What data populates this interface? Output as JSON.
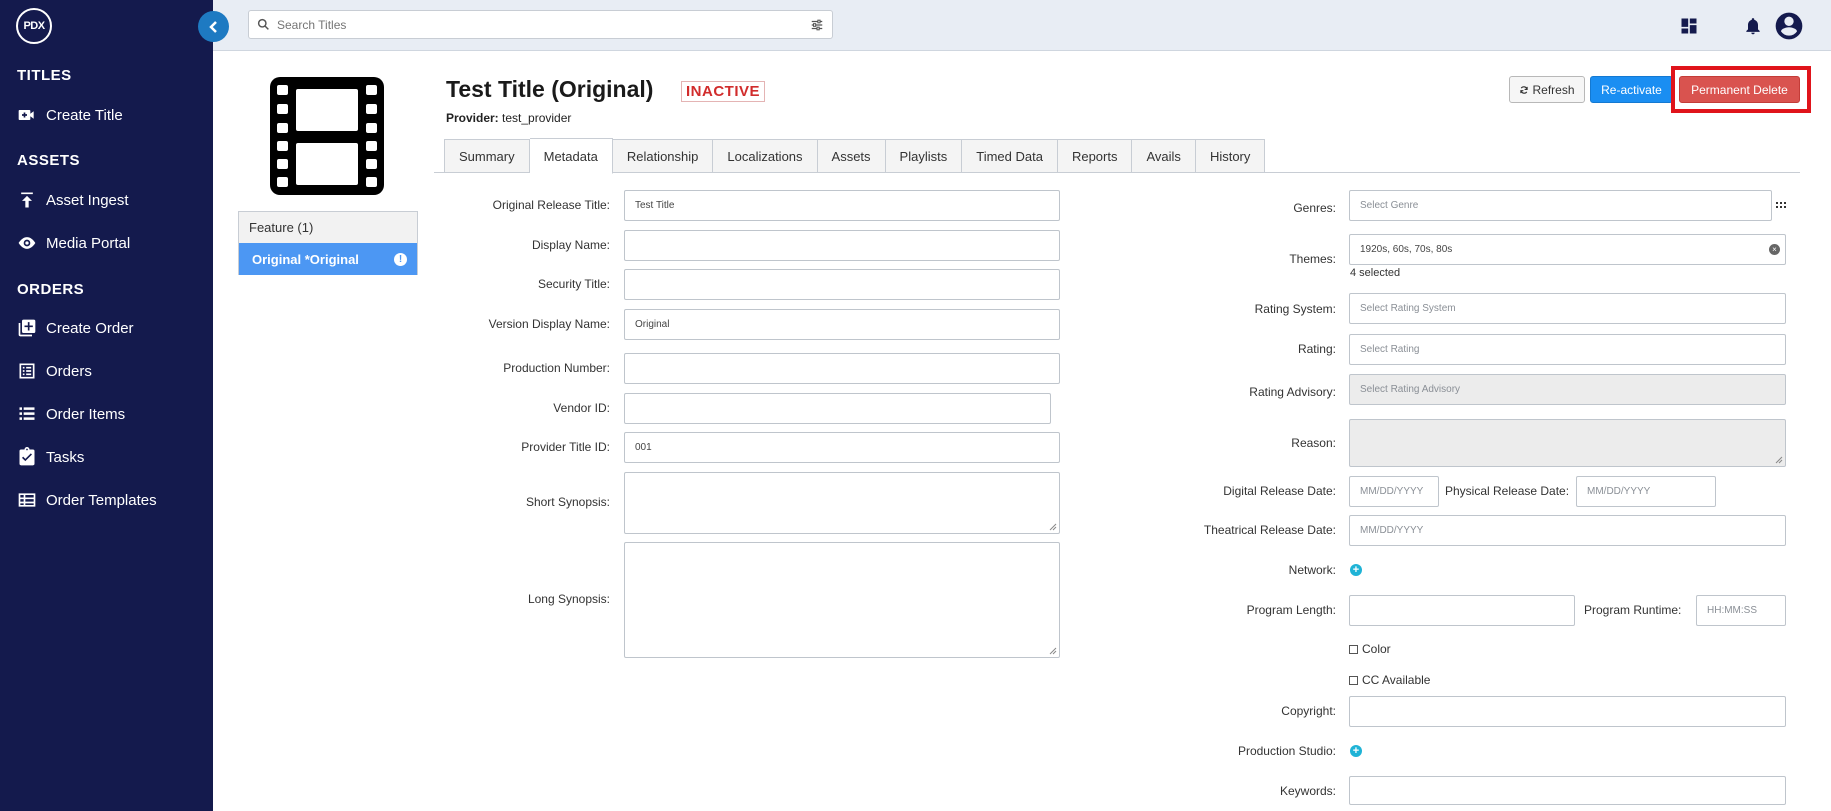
{
  "app": {
    "logo_text": "PDX"
  },
  "sidebar": {
    "sections": [
      {
        "title": "TITLES",
        "items": [
          {
            "label": "Create Title",
            "icon": "video-plus-icon"
          }
        ]
      },
      {
        "title": "ASSETS",
        "items": [
          {
            "label": "Asset Ingest",
            "icon": "upload-icon"
          },
          {
            "label": "Media Portal",
            "icon": "eye-icon"
          }
        ]
      },
      {
        "title": "ORDERS",
        "items": [
          {
            "label": "Create Order",
            "icon": "add-box-icon"
          },
          {
            "label": "Orders",
            "icon": "list-alt-icon"
          },
          {
            "label": "Order Items",
            "icon": "list-icon"
          },
          {
            "label": "Tasks",
            "icon": "clipboard-check-icon"
          },
          {
            "label": "Order Templates",
            "icon": "table-icon"
          }
        ]
      }
    ]
  },
  "search": {
    "placeholder": "Search Titles"
  },
  "title_panel": {
    "feature_label": "Feature (1)",
    "selected_item": "Original *Original"
  },
  "header": {
    "title": "Test Title (Original)",
    "status": "INACTIVE",
    "provider_label": "Provider:",
    "provider_value": "test_provider"
  },
  "actions": {
    "refresh": "Refresh",
    "reactivate": "Re-activate",
    "permanent_delete": "Permanent Delete"
  },
  "tabs": [
    "Summary",
    "Metadata",
    "Relationship",
    "Localizations",
    "Assets",
    "Playlists",
    "Timed Data",
    "Reports",
    "Avails",
    "History"
  ],
  "active_tab": "Metadata",
  "left_form": {
    "original_release_title": {
      "label": "Original Release Title:",
      "value": "Test Title"
    },
    "display_name": {
      "label": "Display Name:",
      "value": ""
    },
    "security_title": {
      "label": "Security Title:",
      "value": ""
    },
    "version_display_name": {
      "label": "Version Display Name:",
      "value": "Original"
    },
    "production_number": {
      "label": "Production Number:",
      "value": ""
    },
    "vendor_id": {
      "label": "Vendor ID:",
      "value": ""
    },
    "provider_title_id": {
      "label": "Provider Title ID:",
      "value": "001"
    },
    "short_synopsis": {
      "label": "Short Synopsis:",
      "value": ""
    },
    "long_synopsis": {
      "label": "Long Synopsis:",
      "value": ""
    }
  },
  "right_form": {
    "genres": {
      "label": "Genres:",
      "placeholder": "Select Genre"
    },
    "themes": {
      "label": "Themes:",
      "value": "1920s, 60s, 70s, 80s",
      "selected_count": "4 selected"
    },
    "rating_system": {
      "label": "Rating System:",
      "placeholder": "Select Rating System"
    },
    "rating": {
      "label": "Rating:",
      "placeholder": "Select Rating"
    },
    "rating_advisory": {
      "label": "Rating Advisory:",
      "placeholder": "Select Rating Advisory"
    },
    "reason": {
      "label": "Reason:"
    },
    "digital_release_date": {
      "label": "Digital Release Date:",
      "placeholder": "MM/DD/YYYY"
    },
    "physical_release_date": {
      "label": "Physical Release Date:",
      "placeholder": "MM/DD/YYYY"
    },
    "theatrical_release_date": {
      "label": "Theatrical Release Date:",
      "placeholder": "MM/DD/YYYY"
    },
    "network": {
      "label": "Network:"
    },
    "program_length": {
      "label": "Program Length:",
      "value": ""
    },
    "program_runtime": {
      "label": "Program Runtime:",
      "placeholder": "HH:MM:SS"
    },
    "color": {
      "label": "Color",
      "checked": false
    },
    "cc_available": {
      "label": "CC Available",
      "checked": false
    },
    "copyright": {
      "label": "Copyright:",
      "value": ""
    },
    "production_studio": {
      "label": "Production Studio:"
    },
    "keywords": {
      "label": "Keywords:",
      "value": ""
    }
  },
  "colors": {
    "sidebar_bg": "#141a4d",
    "accent_blue": "#1a8ef2",
    "selected_item": "#4c97f3",
    "danger": "#d9534f",
    "inactive_red": "#d12c2c",
    "highlight_red": "#e0141b"
  }
}
